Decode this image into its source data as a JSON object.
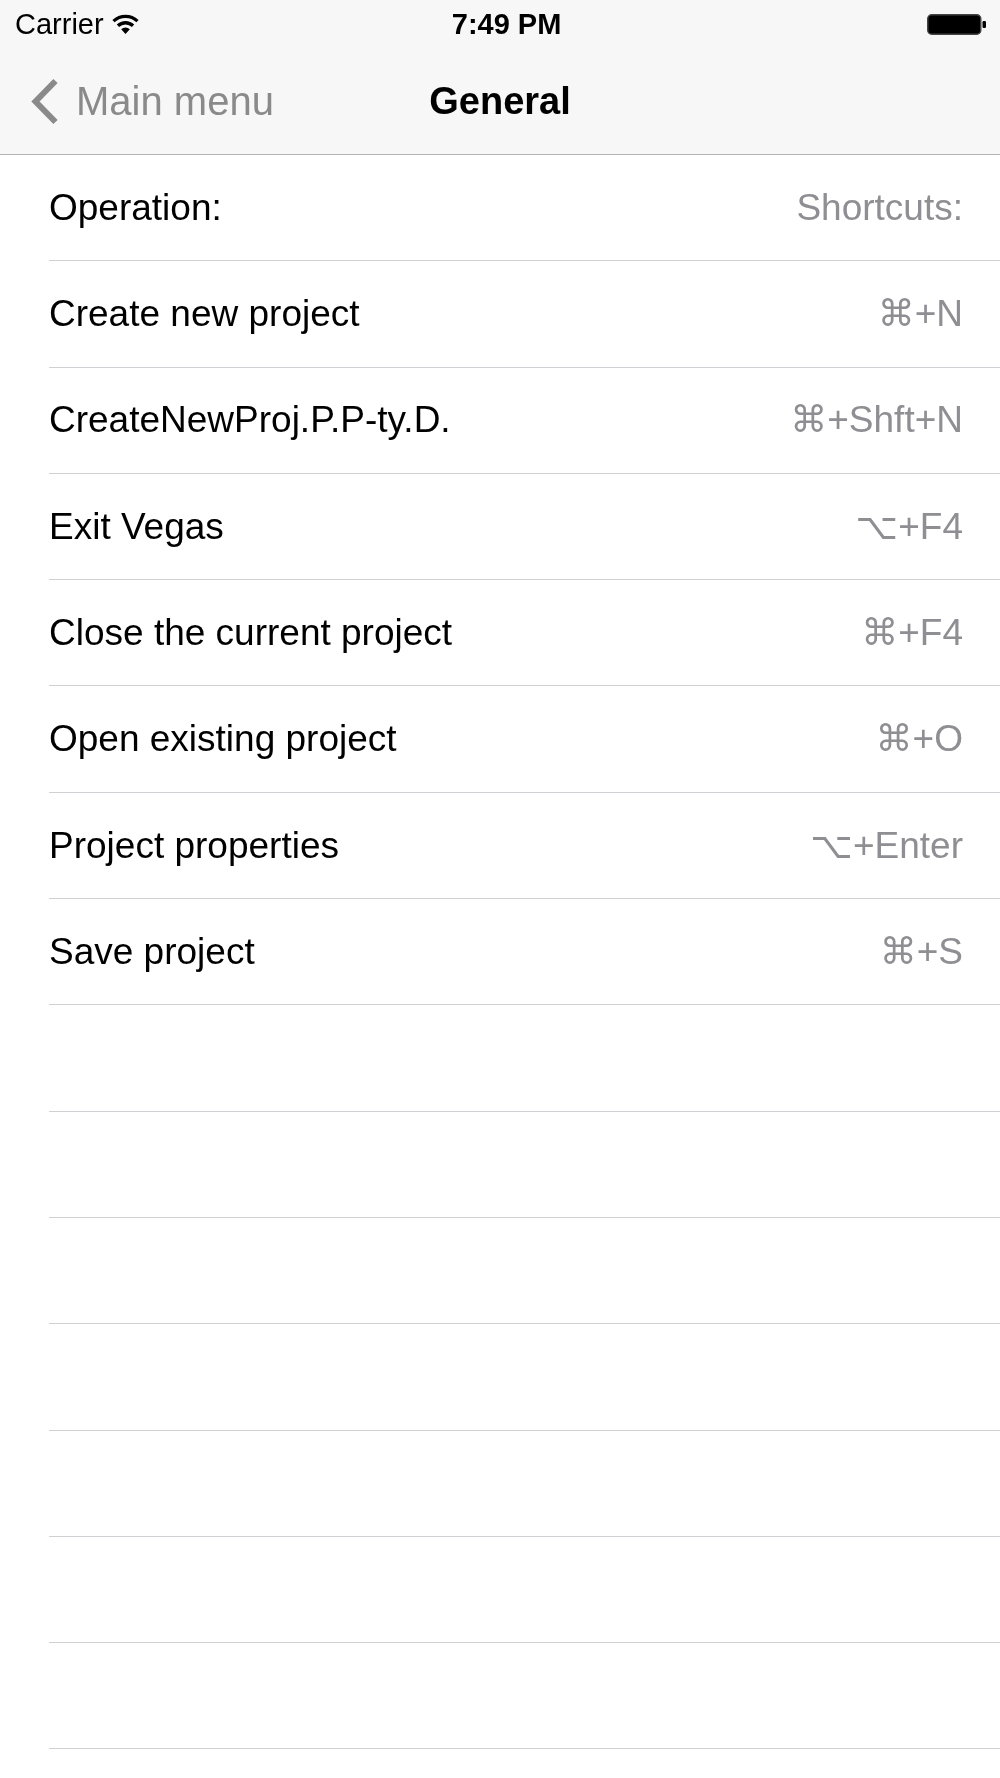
{
  "status_bar": {
    "carrier": "Carrier",
    "time": "7:49 PM"
  },
  "nav_bar": {
    "back": "Main menu",
    "title": "General"
  },
  "table": {
    "columns": [
      "Operation:",
      "Shortcuts:"
    ],
    "rows": [
      {
        "operation": "Create new project",
        "shortcut": "⌘+N"
      },
      {
        "operation": "CreateNewProj.P.P-ty.D.",
        "shortcut": "⌘+Shft+N"
      },
      {
        "operation": "Exit Vegas",
        "shortcut": "⌥+F4"
      },
      {
        "operation": "Close the current project",
        "shortcut": "⌘+F4"
      },
      {
        "operation": "Open existing project",
        "shortcut": "⌘+O"
      },
      {
        "operation": "Project properties",
        "shortcut": "⌥+Enter"
      },
      {
        "operation": "Save project",
        "shortcut": "⌘+S"
      }
    ]
  }
}
